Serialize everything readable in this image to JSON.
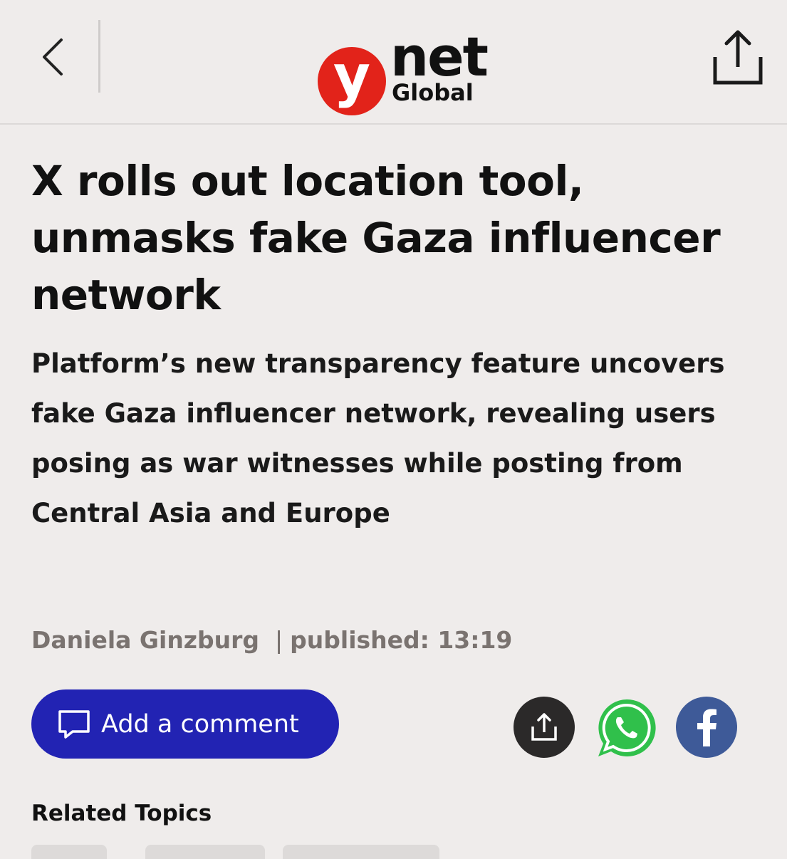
{
  "header": {
    "logo_mark": "y",
    "logo_word": "net",
    "logo_sub": "Global",
    "brand_color": "#e2231a"
  },
  "article": {
    "headline": "X rolls out location tool, unmasks fake Gaza influencer network",
    "subheadline": "Platform’s new transparency feature uncovers fake Gaza influencer network, revealing users posing as war witnesses while posting from Central Asia and Europe",
    "author": "Daniela Ginzburg",
    "separator": "|",
    "published_label": "published: 13:19"
  },
  "actions": {
    "comment_label": "Add a comment",
    "comment_color": "#2223b3",
    "whatsapp_color": "#30c04b",
    "facebook_color": "#3e5a98"
  },
  "related": {
    "title": "Related Topics"
  }
}
